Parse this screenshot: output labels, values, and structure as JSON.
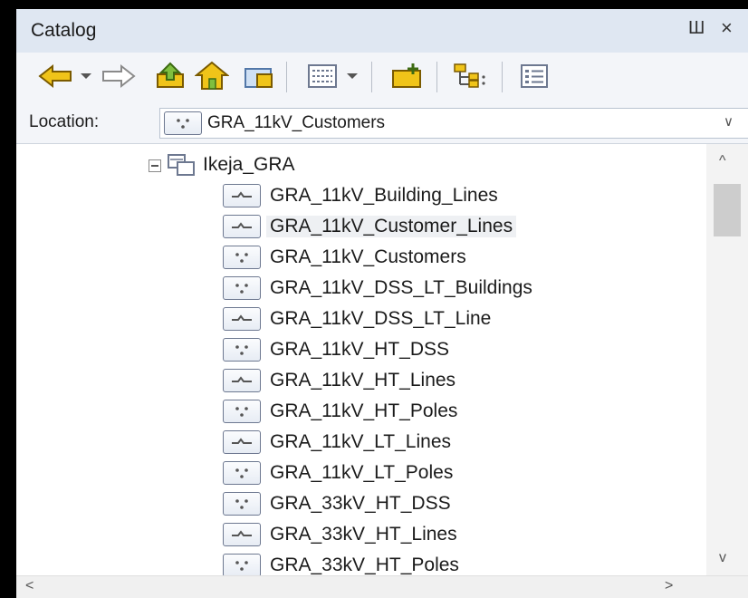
{
  "window": {
    "title": "Catalog",
    "pin_glyph": "Ш",
    "close_glyph": "×"
  },
  "toolbar": {
    "buttons": [
      {
        "name": "back-icon"
      },
      {
        "name": "dropdown-icon"
      },
      {
        "name": "forward-icon"
      },
      {
        "name": "up-folder-icon"
      },
      {
        "name": "home-icon"
      },
      {
        "name": "connect-folder-icon"
      },
      {
        "name": "view-list-icon"
      },
      {
        "name": "view-dropdown-icon"
      },
      {
        "name": "new-folder-icon"
      },
      {
        "name": "tree-icon"
      },
      {
        "name": "details-icon"
      }
    ]
  },
  "location": {
    "label": "Location:",
    "value": "GRA_11kV_Customers",
    "value_icon": "point-feature-class-icon"
  },
  "tree": {
    "root": {
      "label": "Ikeja_GRA",
      "icon": "feature-dataset-icon",
      "expanded": true
    },
    "items": [
      {
        "label": "GRA_11kV_Building_Lines",
        "type": "line"
      },
      {
        "label": "GRA_11kV_Customer_Lines",
        "type": "line",
        "selected": true
      },
      {
        "label": "GRA_11kV_Customers",
        "type": "point"
      },
      {
        "label": "GRA_11kV_DSS_LT_Buildings",
        "type": "point"
      },
      {
        "label": "GRA_11kV_DSS_LT_Line",
        "type": "line"
      },
      {
        "label": "GRA_11kV_HT_DSS",
        "type": "point"
      },
      {
        "label": "GRA_11kV_HT_Lines",
        "type": "line"
      },
      {
        "label": "GRA_11kV_HT_Poles",
        "type": "point"
      },
      {
        "label": "GRA_11kV_LT_Lines",
        "type": "line"
      },
      {
        "label": "GRA_11kV_LT_Poles",
        "type": "point"
      },
      {
        "label": "GRA_33kV_HT_DSS",
        "type": "point"
      },
      {
        "label": "GRA_33kV_HT_Lines",
        "type": "line"
      },
      {
        "label": "GRA_33kV_HT_Poles",
        "type": "point"
      }
    ]
  },
  "scrollbars": {
    "up": "^",
    "down": "v",
    "left": "<",
    "right": ">"
  },
  "colors": {
    "title_bar": "#dfe7f2",
    "toolbar_bg": "#f3f5f9",
    "selection": "#eef0f3",
    "icon_border": "#6d7890",
    "arrow_yellow": "#f0c419"
  }
}
